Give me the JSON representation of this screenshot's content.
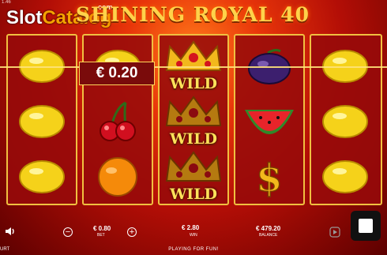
{
  "watermark": {
    "slot": "Slot",
    "catalog": "Catalog",
    "com": "com"
  },
  "version": "1.46",
  "title": "SHINING ROYAL 40",
  "win_badge": "€ 0.20",
  "reels": [
    {
      "symbols": [
        "lemon",
        "lemon",
        "lemon"
      ]
    },
    {
      "symbols": [
        "lemon",
        "cherries",
        "orange"
      ]
    },
    {
      "symbols": [
        "wild",
        "wild",
        "wild"
      ],
      "wild_label": "WILD"
    },
    {
      "symbols": [
        "plum",
        "watermelon",
        "dollar"
      ]
    },
    {
      "symbols": [
        "lemon",
        "lemon",
        "lemon"
      ]
    }
  ],
  "bottom": {
    "bet_value": "€ 0.80",
    "bet_label": "BET",
    "win_value": "€ 2.80",
    "win_label": "WIN",
    "balance_value": "€ 479.20",
    "balance_label": "BALANCE",
    "playing_text": "PLAYING FOR FUN!",
    "brand": "URT"
  },
  "icons": {
    "sound": "speaker-icon",
    "minus": "minus-icon",
    "plus": "plus-icon",
    "autoplay": "autoplay-icon",
    "spin": "spin-stop-icon"
  },
  "colors": {
    "frame": "#f0c040",
    "reel_bg": "#960a0a",
    "title": "#ffd24a",
    "win_text": "#ffd65a"
  }
}
